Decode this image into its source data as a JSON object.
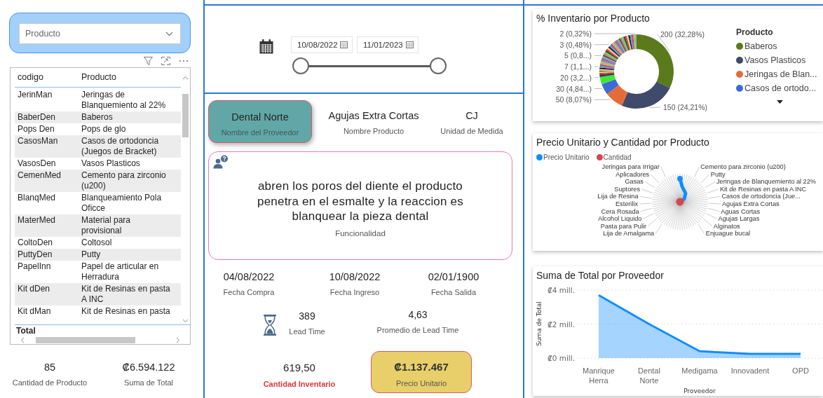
{
  "product_slicer": {
    "placeholder": "Producto"
  },
  "table": {
    "columns": [
      "codigo",
      "Producto"
    ],
    "rows": [
      {
        "codigo": "JerinMan",
        "producto": "Jeringas de Blanquemiento al 22%"
      },
      {
        "codigo": "BaberDen",
        "producto": "Baberos"
      },
      {
        "codigo": "Pops Den",
        "producto": "Pops de glo"
      },
      {
        "codigo": "CasosMan",
        "producto": "Casos de ortodoncia (Juegos de Bracket)"
      },
      {
        "codigo": "VasosDen",
        "producto": "Vasos Plasticos"
      },
      {
        "codigo": "CemenMed",
        "producto": "Cemento para zirconio (u200)"
      },
      {
        "codigo": "BlanqMed",
        "producto": "Blanqueamiento Pola Oficce"
      },
      {
        "codigo": "MaterMed",
        "producto": "Material para provisional"
      },
      {
        "codigo": "ColtoDen",
        "producto": "Coltosol"
      },
      {
        "codigo": "PuttyDen",
        "producto": "Putty"
      },
      {
        "codigo": "PapelInn",
        "producto": "Papel de articular en Herradura"
      },
      {
        "codigo": "Kit dDen",
        "producto": "Kit de Resinas en pasta A INC"
      },
      {
        "codigo": "Kit dMan",
        "producto": "Kit de Resinas en pasta"
      }
    ],
    "total_label": "Total"
  },
  "summary_cards": [
    {
      "value": "85",
      "label": "Cantidad de Producto"
    },
    {
      "value": "₡6.594.122",
      "label": "Suma de Total"
    }
  ],
  "date_slicer": {
    "start": "10/08/2022",
    "end": "11/01/2023",
    "thumbs": [
      {
        "level": 0
      },
      {
        "level": 1
      }
    ]
  },
  "detail_cards": [
    {
      "value": "Dental Norte",
      "label": "Nombre del Proveedor",
      "kind": "accent"
    },
    {
      "value": "Agujas Extra Cortas",
      "label": "Nombre Producto",
      "kind": "plain"
    },
    {
      "value": "CJ",
      "label": "Unidad de Medida",
      "kind": "plain"
    }
  ],
  "function_card": {
    "text": "abren los poros del diente el producto penetra en el esmalte y la reaccion es blanquear la pieza dental",
    "label": "Funcionalidad"
  },
  "date_cards": [
    {
      "value": "04/08/2022",
      "label": "Fecha Compra"
    },
    {
      "value": "10/08/2022",
      "label": "Fecha Ingreso"
    },
    {
      "value": "02/01/1900",
      "label": "Fecha Salida"
    }
  ],
  "lead_cards": [
    {
      "value": "389",
      "label": "Lead Time"
    },
    {
      "value": "4,63",
      "label": "Promedio de Lead Time"
    }
  ],
  "bottom_cards": [
    {
      "value": "619,50",
      "label": "Cantidad Inventario",
      "kind": "alert"
    },
    {
      "value": "₡1.137.467",
      "label": "Precio Unitario",
      "kind": "gold"
    }
  ],
  "inventory_chart": {
    "title": "% Inventario por Producto",
    "slice_labels": [
      {
        "text": "2 (0,32%)",
        "kind": "left"
      },
      {
        "text": "200 (32,28%)",
        "kind": "right"
      },
      {
        "text": "3 (0,48%)",
        "kind": "left"
      },
      {
        "text": "5 (0,8...)",
        "kind": "left"
      },
      {
        "text": "7 (1,1...)",
        "kind": "left"
      },
      {
        "text": "20 (3,2...)",
        "kind": "left"
      },
      {
        "text": "30 (4,84...)",
        "kind": "left"
      },
      {
        "text": "50 (8,07%)",
        "kind": "left"
      },
      {
        "text": "150 (24,21%)",
        "kind": "right"
      }
    ],
    "legend": {
      "title": "Producto",
      "items": [
        {
          "label": "Baberos",
          "color": "#5b7a1c"
        },
        {
          "label": "Vasos Plasticos",
          "color": "#404b6b"
        },
        {
          "label": "Jeringas de Blan...",
          "color": "#e66c37"
        },
        {
          "label": "Casos de ortodo...",
          "color": "#3d6ad6"
        }
      ]
    }
  },
  "price_chart": {
    "title": "Precio Unitario y Cantidad por Producto",
    "legend": [
      {
        "label": "Precio Unitario",
        "color": "#118dff"
      },
      {
        "label": "Cantidad",
        "color": "#d9454f"
      }
    ],
    "left_labels": [
      "Jeringas para Irrigar",
      "Aplicadores",
      "Gasas",
      "Suptores",
      "Lija de Resina",
      "Esterilix",
      "Cera Rosada",
      "Alcohol Liquido",
      "Pasta para Pulir",
      "Lija de Amalgama"
    ],
    "right_labels": [
      "Cemento para zirconio (u200)",
      "Putty",
      "Jeringas de Blanquemiento al 22%",
      "Kit de Resinas en pasta A INC",
      "Casos de ortodoncia (Jue...",
      "Agujas Extra Cortas",
      "Aguas Cortas",
      "Agujas Largas",
      "Alginatos",
      "Enjuague bucal"
    ]
  },
  "supplier_chart": {
    "title": "Suma de Total por Proveedor",
    "chart_data": {
      "type": "area",
      "categories": [
        "Manrique Herra",
        "Dental Norte",
        "Medigama",
        "Innovadent",
        "OPD"
      ],
      "series": [
        {
          "color": "#118dff",
          "values": [
            3.7,
            2.0,
            0.4,
            0.25,
            0.25
          ]
        }
      ],
      "ylim": [
        0,
        4
      ],
      "yticks": [
        {
          "value": 0,
          "label": "₡0 mill."
        },
        {
          "value": 2,
          "label": "₡2 mill."
        },
        {
          "value": 4,
          "label": "₡4 mill."
        }
      ],
      "xlabel": "Proveedor",
      "ylabel": "Suma de Total"
    }
  }
}
